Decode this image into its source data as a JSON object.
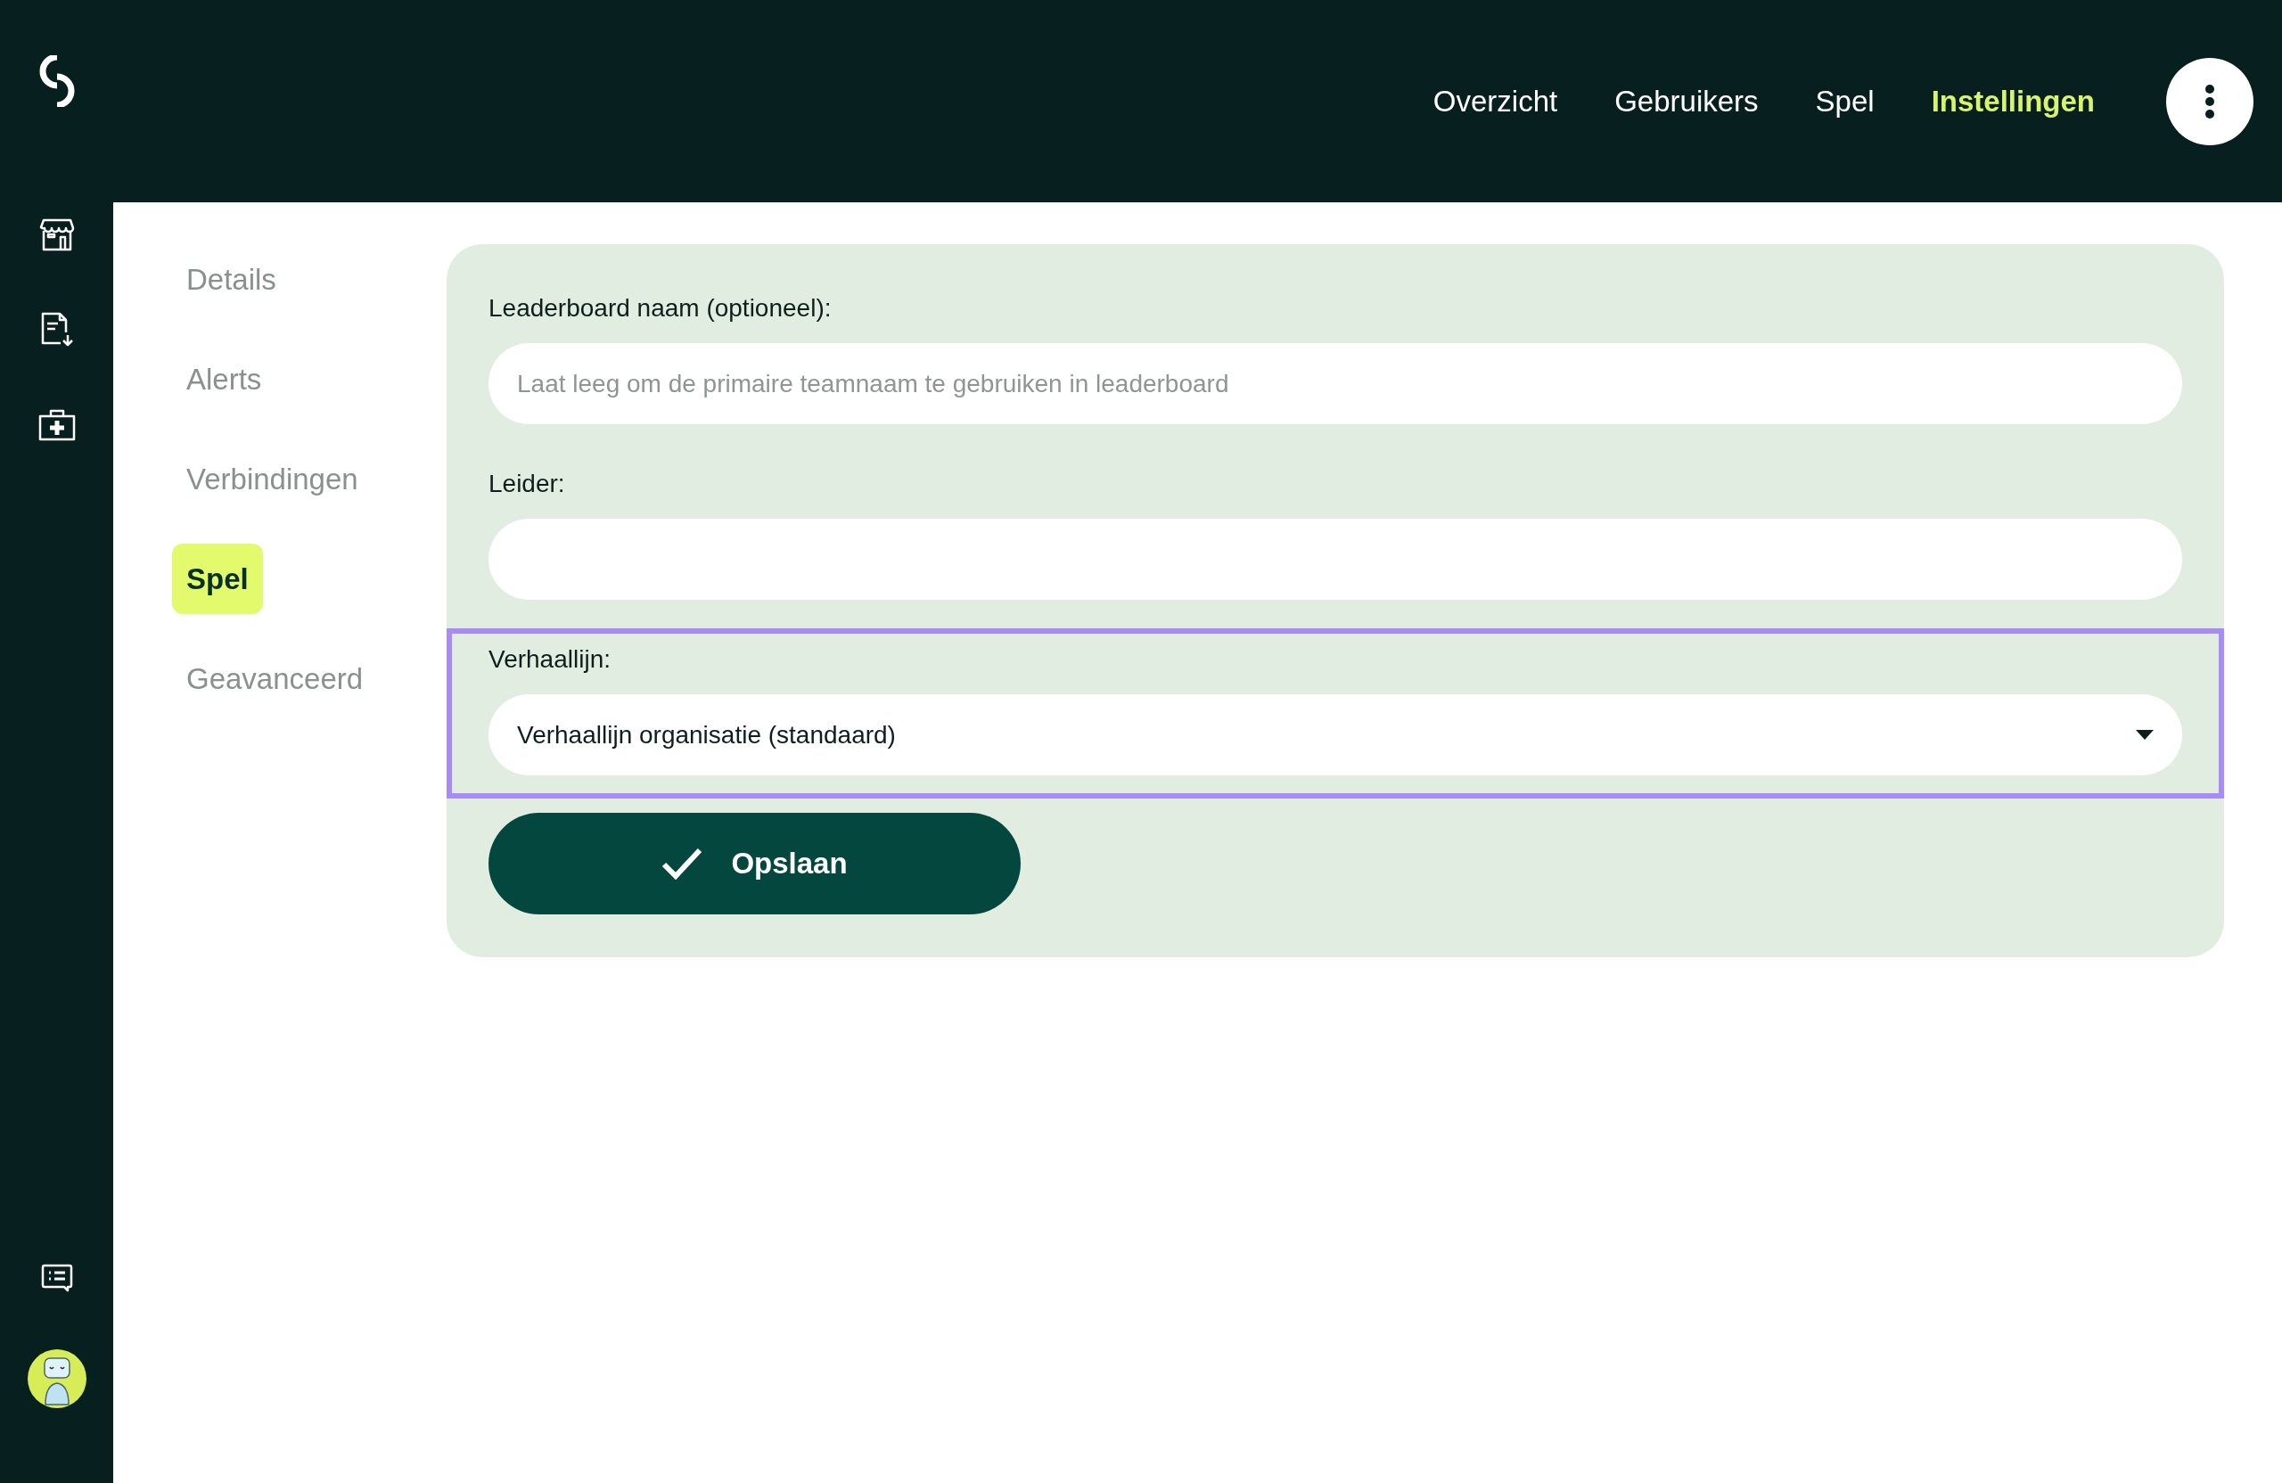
{
  "top_nav": {
    "items": [
      {
        "label": "Overzicht",
        "selected": false
      },
      {
        "label": "Gebruikers",
        "selected": false
      },
      {
        "label": "Spel",
        "selected": false
      },
      {
        "label": "Instellingen",
        "selected": true
      }
    ]
  },
  "settings_nav": {
    "items": [
      {
        "label": "Details",
        "selected": false
      },
      {
        "label": "Alerts",
        "selected": false
      },
      {
        "label": "Verbindingen",
        "selected": false
      },
      {
        "label": "Spel",
        "selected": true
      },
      {
        "label": "Geavanceerd",
        "selected": false
      }
    ]
  },
  "form": {
    "fields": [
      {
        "kind": "text",
        "label": "Leaderboard naam (optioneel):",
        "placeholder": "Laat leeg om de primaire teamnaam te gebruiken in leaderboard",
        "highlighted": false
      },
      {
        "kind": "text",
        "label": "Leider:",
        "highlighted": false
      },
      {
        "kind": "select",
        "label": "Verhaallijn:",
        "value": "Verhaallijn organisatie (standaard)",
        "highlighted": true
      }
    ],
    "save_button": {
      "label": "Opslaan"
    }
  }
}
